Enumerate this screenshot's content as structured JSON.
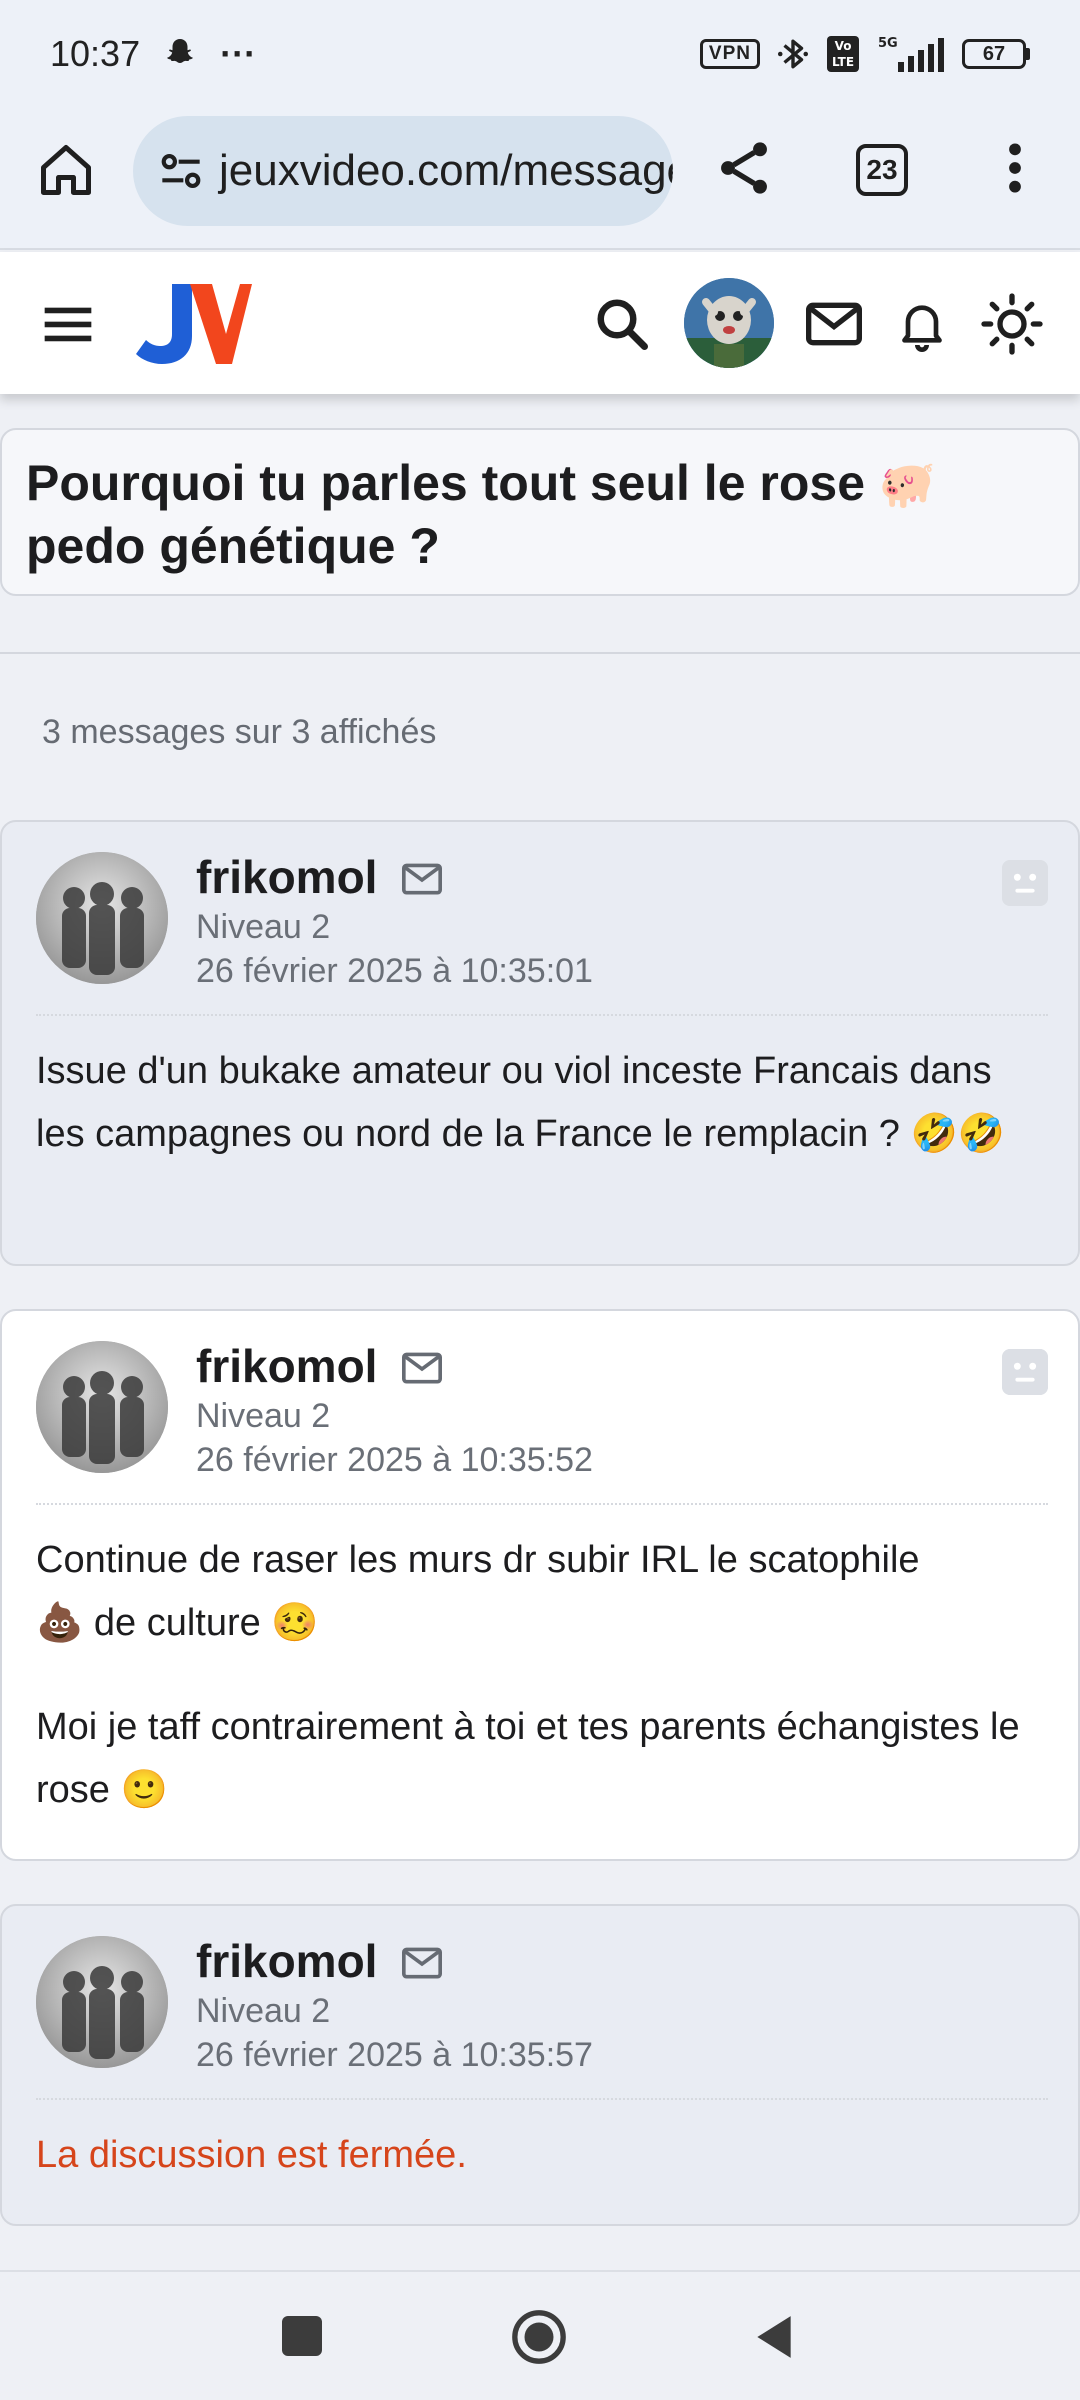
{
  "status_bar": {
    "time": "10:37",
    "more": "···",
    "vpn": "VPN",
    "battery": "67",
    "icons": [
      "snapchat-icon",
      "bluetooth-icon",
      "volte-icon",
      "5g-signal-icon",
      "battery-icon"
    ]
  },
  "browser": {
    "url": "jeuxvideo.com/messages",
    "tab_count": "23",
    "icons": [
      "home-icon",
      "site-info-icon",
      "share-icon",
      "tabs-icon",
      "more-vert-icon"
    ]
  },
  "site_header": {
    "logo_text": "JV",
    "logo_colors": {
      "j": "#1f5fd6",
      "v": "#f2461d"
    },
    "icons": [
      "menu-icon",
      "search-icon",
      "avatar",
      "mail-icon",
      "bell-icon",
      "sun-icon"
    ]
  },
  "topic": {
    "title": "Pourquoi tu parles tout seul le rose",
    "title_emoji": "🐖",
    "title_end": "pedo génétique ?",
    "count": "3 messages sur 3 affichés"
  },
  "messages": [
    {
      "author": "frikomol",
      "level": "Niveau 2",
      "date": "26 février 2025 à 10:35:01",
      "text": "Issue d'un bukake amateur ou viol inceste Francais dans les campagnes ou nord de la France le remplacin ?",
      "emoji": "🤣🤣"
    },
    {
      "author": "frikomol",
      "level": "Niveau 2",
      "date": "26 février 2025 à 10:35:52",
      "para1_a": "Continue de raser les murs dr subir IRL le scatophile",
      "para1_emoji_a": "💩",
      "para1_b": "de culture",
      "para1_emoji_b": "🥴",
      "para2": "Moi je taff contrairement à toi et tes parents échangistes le rose",
      "para2_emoji": "🙂"
    },
    {
      "author": "frikomol",
      "level": "Niveau 2",
      "date": "26 février 2025 à 10:35:57",
      "closed_text": "La discussion est fermée.",
      "closed_color": "#d6451b"
    }
  ]
}
